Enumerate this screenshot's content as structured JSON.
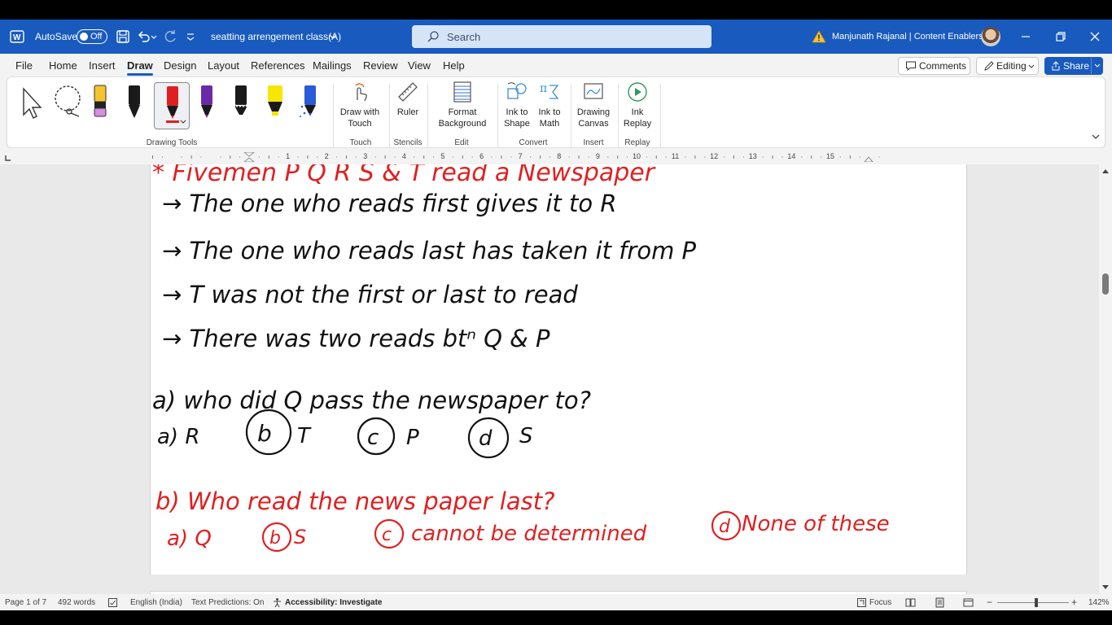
{
  "titlebar": {
    "autosave_label": "AutoSave",
    "autosave_state": "Off",
    "document_title": "seatting arrengement class(A)",
    "search_placeholder": "Search",
    "user_name": "Manjunath Rajanal | Content Enablers",
    "brand_color": "#185abd"
  },
  "menu": {
    "tabs": [
      "File",
      "Home",
      "Insert",
      "Draw",
      "Design",
      "Layout",
      "References",
      "Mailings",
      "Review",
      "View",
      "Help"
    ],
    "active_tab": "Draw",
    "comments_label": "Comments",
    "editing_label": "Editing",
    "share_label": "Share"
  },
  "ribbon": {
    "groups": {
      "drawing_tools": "Drawing Tools",
      "touch": "Touch",
      "stencils": "Stencils",
      "edit": "Edit",
      "convert": "Convert",
      "insert": "Insert",
      "replay": "Replay"
    },
    "buttons": {
      "draw_with_touch_1": "Draw with",
      "draw_with_touch_2": "Touch",
      "ruler": "Ruler",
      "format_background_1": "Format",
      "format_background_2": "Background",
      "ink_to_shape_1": "Ink to",
      "ink_to_shape_2": "Shape",
      "ink_to_math_1": "Ink to",
      "ink_to_math_2": "Math",
      "drawing_canvas_1": "Drawing",
      "drawing_canvas_2": "Canvas",
      "ink_replay_1": "Ink",
      "ink_replay_2": "Replay"
    },
    "pen_colors": [
      "#1a1a1a",
      "#e02020",
      "#6a2aa8",
      "#1a1a1a",
      "#f6e600",
      "#2a5bd8"
    ],
    "highlighter_color": "#f4c430"
  },
  "ruler": {
    "numbers": [
      "1",
      "2",
      "3",
      "4",
      "5",
      "6",
      "7",
      "8",
      "9",
      "10",
      "11",
      "12",
      "13",
      "14",
      "15"
    ]
  },
  "document": {
    "ink_red": "#e02020",
    "ink_black": "#111111",
    "lines": {
      "heading": "* Fivemen P Q R S & T read a Newspaper",
      "clue1": "→ The one who reads first gives it to R",
      "clue2": "→ The one who reads last has taken it from P",
      "clue3": "→ T was not the first or last to read",
      "clue4": "→ There was two reads btⁿ Q & P",
      "q1": "a) who did Q pass the newspaper to?",
      "q1_a": "a) R",
      "q1_b": "b",
      "q1_b_text": "T",
      "q1_c": "c",
      "q1_c_text": "P",
      "q1_d": "d",
      "q1_d_text": "S",
      "q2": "b) Who read the news paper last?",
      "q2_a": "a) Q",
      "q2_b": "b",
      "q2_b_text": "S",
      "q2_c": "c",
      "q2_c_text": "cannot be determined",
      "q2_d": "d",
      "q2_d_text": "None of these"
    }
  },
  "statusbar": {
    "page": "Page 1 of 7",
    "words": "492 words",
    "language": "English (India)",
    "text_predictions": "Text Predictions: On",
    "accessibility": "Accessibility: Investigate",
    "focus": "Focus",
    "zoom": "142%"
  }
}
